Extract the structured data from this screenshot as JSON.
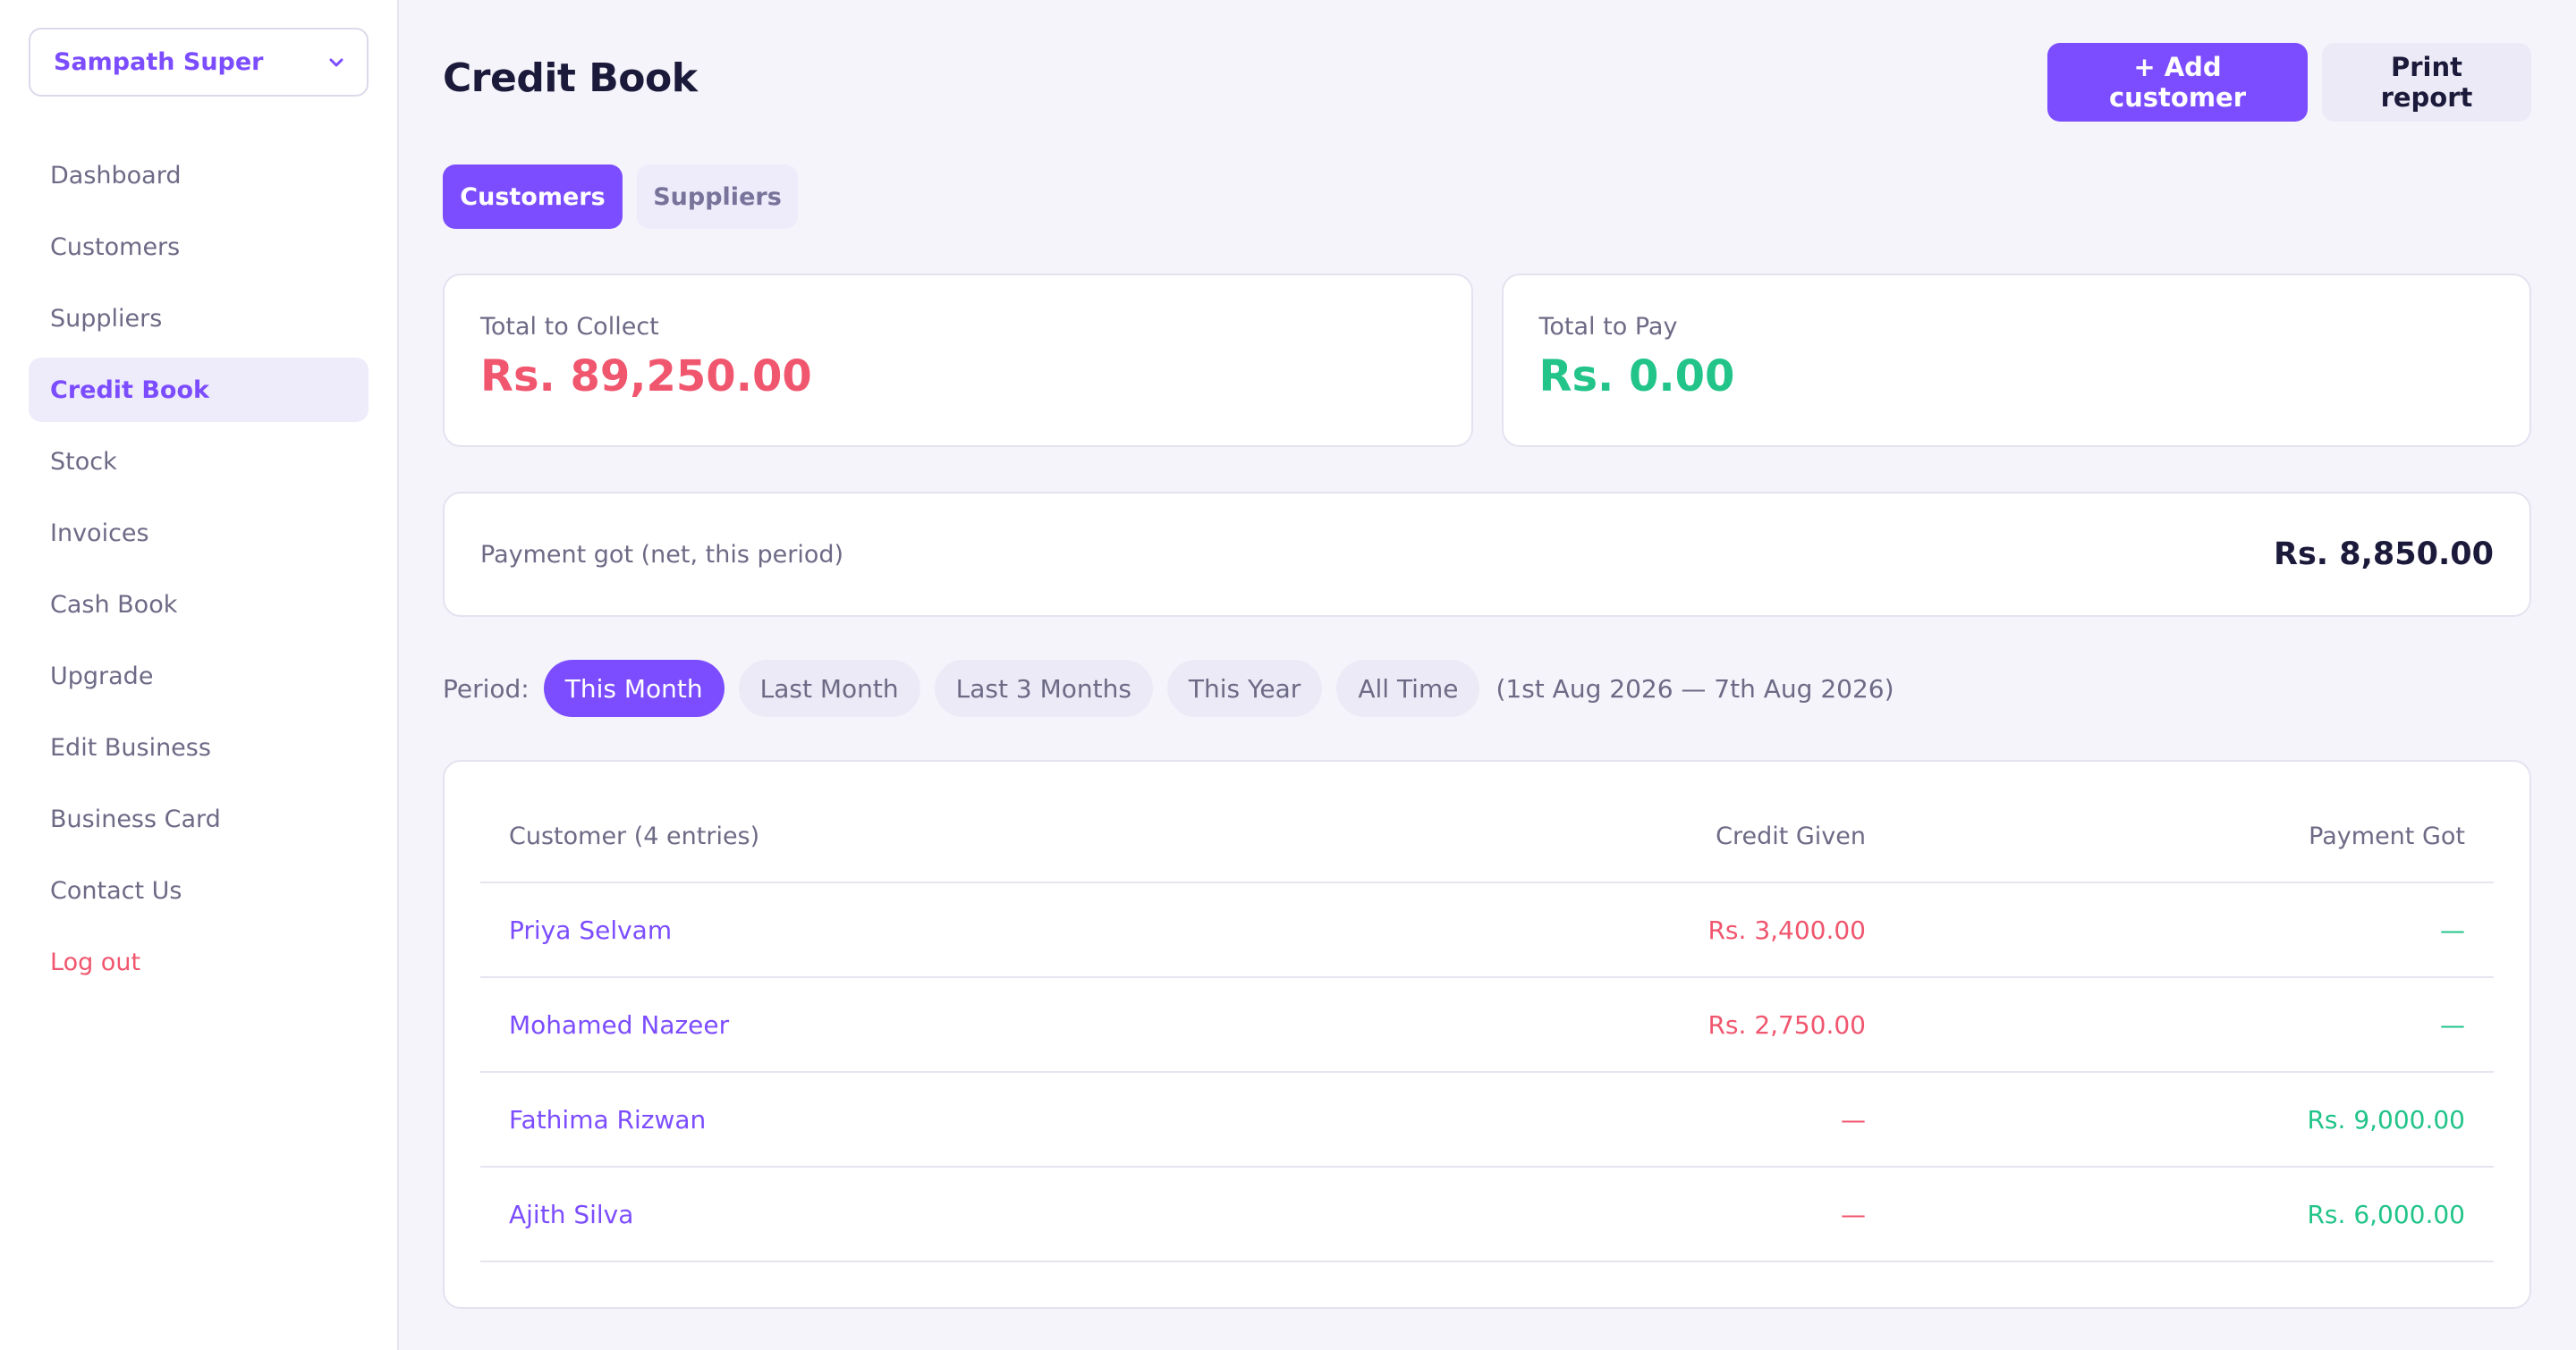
{
  "business": {
    "name": "Sampath Super"
  },
  "sidebar": {
    "items": [
      {
        "label": "Dashboard"
      },
      {
        "label": "Customers"
      },
      {
        "label": "Suppliers"
      },
      {
        "label": "Credit Book"
      },
      {
        "label": "Stock"
      },
      {
        "label": "Invoices"
      },
      {
        "label": "Cash Book"
      },
      {
        "label": "Upgrade"
      },
      {
        "label": "Edit Business"
      },
      {
        "label": "Business Card"
      },
      {
        "label": "Contact Us"
      },
      {
        "label": "Log out"
      }
    ],
    "active_item": "Credit Book"
  },
  "header": {
    "title": "Credit Book",
    "add_customer_label": "+ Add customer",
    "print_report_label": "Print report"
  },
  "tabs": [
    {
      "label": "Customers",
      "active": true
    },
    {
      "label": "Suppliers",
      "active": false
    }
  ],
  "summary": {
    "collect_label": "Total to Collect",
    "collect_value": "Rs. 89,250.00",
    "pay_label": "Total to Pay",
    "pay_value": "Rs. 0.00",
    "net_label": "Payment got (net, this period)",
    "net_value": "Rs. 8,850.00"
  },
  "period": {
    "label": "Period:",
    "options": [
      {
        "label": "This Month",
        "active": true
      },
      {
        "label": "Last Month",
        "active": false
      },
      {
        "label": "Last 3 Months",
        "active": false
      },
      {
        "label": "This Year",
        "active": false
      },
      {
        "label": "All Time",
        "active": false
      }
    ],
    "range": "(1st Aug 2026 — 7th Aug 2026)"
  },
  "table": {
    "headers": {
      "customer": "Customer (4 entries)",
      "credit": "Credit Given",
      "payment": "Payment Got"
    },
    "rows": [
      {
        "customer": "Priya Selvam",
        "credit": "Rs. 3,400.00",
        "payment": "—"
      },
      {
        "customer": "Mohamed Nazeer",
        "credit": "Rs. 2,750.00",
        "payment": "—"
      },
      {
        "customer": "Fathima Rizwan",
        "credit": "—",
        "payment": "Rs. 9,000.00"
      },
      {
        "customer": "Ajith Silva",
        "credit": "—",
        "payment": "Rs. 6,000.00"
      }
    ]
  },
  "colors": {
    "accent": "#7c4dff",
    "collect": "#f0566e",
    "pay": "#22c48a"
  }
}
